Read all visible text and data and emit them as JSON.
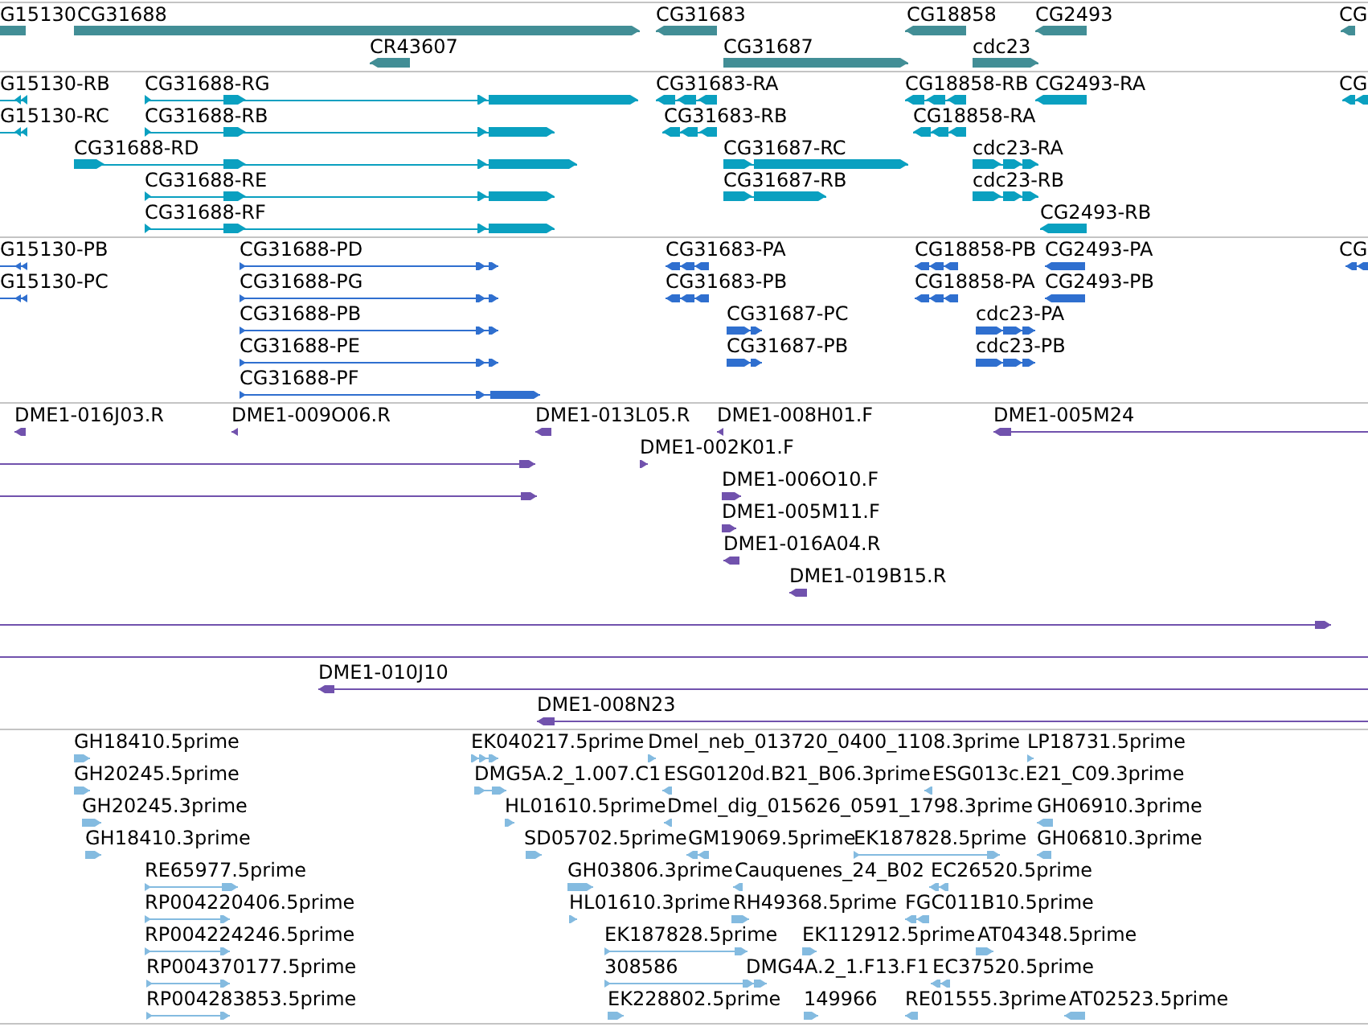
{
  "tracks": [
    {
      "color": "#428e96",
      "features": [
        {
          "label": "G15130",
          "reverse": true
        },
        {
          "label": "CG31688",
          "reverse": false
        },
        {
          "label": "CG31683",
          "reverse": true
        },
        {
          "label": "CG18858",
          "reverse": true
        },
        {
          "label": "CG2493",
          "reverse": true
        },
        {
          "label": "CG",
          "reverse": true
        },
        {
          "label": "CR43607",
          "reverse": true
        },
        {
          "label": "CG31687",
          "reverse": false
        },
        {
          "label": "cdc23",
          "reverse": false
        }
      ]
    },
    {
      "color": "#0aa0c0",
      "features": [
        {
          "label": "G15130-RB",
          "reverse": true
        },
        {
          "label": "CG31688-RG",
          "reverse": false
        },
        {
          "label": "CG31683-RA",
          "reverse": true
        },
        {
          "label": "CG18858-RB",
          "reverse": true
        },
        {
          "label": "CG2493-RA",
          "reverse": true
        },
        {
          "label": "CG",
          "reverse": true
        },
        {
          "label": "G15130-RC",
          "reverse": true
        },
        {
          "label": "CG31688-RB",
          "reverse": false
        },
        {
          "label": "CG31683-RB",
          "reverse": true
        },
        {
          "label": "CG18858-RA",
          "reverse": true
        },
        {
          "label": "CG31688-RD",
          "reverse": false
        },
        {
          "label": "CG31687-RC",
          "reverse": false
        },
        {
          "label": "cdc23-RA",
          "reverse": false
        },
        {
          "label": "CG31688-RE",
          "reverse": false
        },
        {
          "label": "CG31687-RB",
          "reverse": false
        },
        {
          "label": "cdc23-RB",
          "reverse": false
        },
        {
          "label": "CG31688-RF",
          "reverse": false
        },
        {
          "label": "CG2493-RB",
          "reverse": true
        }
      ]
    },
    {
      "color": "#2f6fcf",
      "features": [
        {
          "label": "G15130-PB",
          "reverse": true
        },
        {
          "label": "CG31688-PD",
          "reverse": false
        },
        {
          "label": "CG31683-PA",
          "reverse": true
        },
        {
          "label": "CG18858-PB",
          "reverse": true
        },
        {
          "label": "CG2493-PA",
          "reverse": true
        },
        {
          "label": "CG",
          "reverse": true
        },
        {
          "label": "G15130-PC",
          "reverse": true
        },
        {
          "label": "CG31688-PG",
          "reverse": false
        },
        {
          "label": "CG31683-PB",
          "reverse": true
        },
        {
          "label": "CG18858-PA",
          "reverse": true
        },
        {
          "label": "CG2493-PB",
          "reverse": true
        },
        {
          "label": "CG31688-PB",
          "reverse": false
        },
        {
          "label": "CG31687-PC",
          "reverse": false
        },
        {
          "label": "cdc23-PA",
          "reverse": false
        },
        {
          "label": "CG31688-PE",
          "reverse": false
        },
        {
          "label": "CG31687-PB",
          "reverse": false
        },
        {
          "label": "cdc23-PB",
          "reverse": false
        },
        {
          "label": "CG31688-PF",
          "reverse": false
        }
      ]
    },
    {
      "color": "#7152ad",
      "features": [
        {
          "label": "DME1-016J03.R",
          "reverse": true
        },
        {
          "label": "DME1-009O06.R",
          "reverse": true
        },
        {
          "label": "DME1-013L05.R",
          "reverse": true
        },
        {
          "label": "DME1-008H01.F",
          "reverse": true
        },
        {
          "label": "DME1-005M24",
          "reverse": true
        },
        {
          "reverse": false
        },
        {
          "label": "DME1-002K01.F",
          "reverse": false
        },
        {
          "reverse": false
        },
        {
          "label": "DME1-006O10.F",
          "reverse": false
        },
        {
          "label": "DME1-005M11.F",
          "reverse": false
        },
        {
          "label": "DME1-016A04.R",
          "reverse": true
        },
        {
          "label": "DME1-019B15.R",
          "reverse": true
        },
        {
          "reverse": false
        },
        {
          "label": "DME1-010J10",
          "reverse": true
        },
        {
          "label": "DME1-008N23",
          "reverse": true
        }
      ]
    },
    {
      "color": "#84bbe0",
      "features": [
        {
          "label": "GH18410.5prime",
          "reverse": false
        },
        {
          "label": "EK040217.5prime",
          "reverse": false
        },
        {
          "label": "Dmel_neb_013720_0400_1108.3prime",
          "reverse": false
        },
        {
          "label": "LP18731.5prime",
          "reverse": false
        },
        {
          "label": "GH20245.5prime",
          "reverse": false
        },
        {
          "label": "DMG5A.2_1.007.C1",
          "reverse": false
        },
        {
          "label": "ESG0120d.B21_B06.3prime",
          "reverse": true
        },
        {
          "label": "ESG013c.E21_C09.3prime",
          "reverse": true
        },
        {
          "label": "GH20245.3prime",
          "reverse": false
        },
        {
          "label": "HL01610.5prime",
          "reverse": false
        },
        {
          "label": "Dmel_dig_015626_0591_1798.3prime",
          "reverse": true
        },
        {
          "label": "GH06910.3prime",
          "reverse": true
        },
        {
          "label": "GH18410.3prime",
          "reverse": false
        },
        {
          "label": "SD05702.5prime",
          "reverse": false
        },
        {
          "label": "GM19069.5prime",
          "reverse": true
        },
        {
          "label": "EK187828.5prime",
          "reverse": false
        },
        {
          "label": "GH06810.3prime",
          "reverse": true
        },
        {
          "label": "RE65977.5prime",
          "reverse": false
        },
        {
          "label": "GH03806.3prime",
          "reverse": false
        },
        {
          "label": "Cauquenes_24_B02",
          "reverse": true
        },
        {
          "label": "EC26520.5prime",
          "reverse": true
        },
        {
          "label": "RP004220406.5prime",
          "reverse": false
        },
        {
          "label": "HL01610.3prime",
          "reverse": false
        },
        {
          "label": "RH49368.5prime",
          "reverse": false
        },
        {
          "label": "FGC011B10.5prime",
          "reverse": true
        },
        {
          "label": "RP004224246.5prime",
          "reverse": false
        },
        {
          "label": "EK187828.5prime",
          "reverse": false
        },
        {
          "label": "EK112912.5prime",
          "reverse": false
        },
        {
          "label": "AT04348.5prime",
          "reverse": false
        },
        {
          "label": "RP004370177.5prime",
          "reverse": false
        },
        {
          "label": "308586",
          "reverse": false
        },
        {
          "label": "DMG4A.2_1.F13.F1"
        },
        {
          "label": "EC37520.5prime",
          "reverse": true
        },
        {
          "label": "RP004283853.5prime",
          "reverse": false
        },
        {
          "label": "EK228802.5prime",
          "reverse": false
        },
        {
          "label": "149966",
          "reverse": false
        },
        {
          "label": "RE01555.3prime",
          "reverse": true
        },
        {
          "label": "AT02523.5prime",
          "reverse": true
        }
      ]
    }
  ]
}
